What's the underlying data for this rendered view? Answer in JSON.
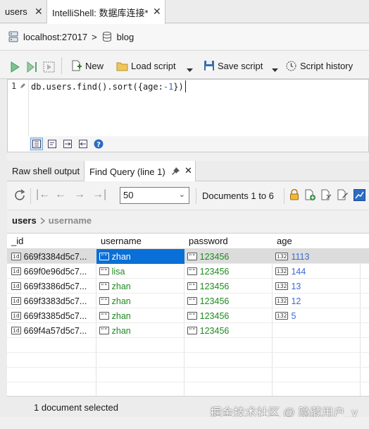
{
  "tabs": [
    {
      "label": "users",
      "close": "✕"
    },
    {
      "label": "IntelliShell: 数据库连接*",
      "close": "✕"
    }
  ],
  "connection": {
    "host": "localhost:27017",
    "separator": ">",
    "database": "blog"
  },
  "toolbar": {
    "new_label": "New",
    "load_label": "Load script",
    "save_label": "Save script",
    "history_label": "Script history"
  },
  "editor": {
    "line_number": "1",
    "code_prefix": "db.users.find().sort({age:",
    "code_number": "-1",
    "code_suffix": "})"
  },
  "result_tabs": [
    {
      "label": "Raw shell output"
    },
    {
      "label": "Find Query (line 1)"
    }
  ],
  "result_toolbar": {
    "page_size": "50",
    "documents_label": "Documents 1 to 6"
  },
  "collection_path": {
    "collection": "users",
    "field": "username"
  },
  "grid": {
    "columns": [
      "_id",
      "username",
      "password",
      "age"
    ],
    "rows": [
      {
        "id": "669f3384d5c7...",
        "username": "zhan",
        "password": "123456",
        "age": "1113"
      },
      {
        "id": "669f0e96d5c7...",
        "username": "lisa",
        "password": "123456",
        "age": "144"
      },
      {
        "id": "669f3386d5c7...",
        "username": "zhan",
        "password": "123456",
        "age": "13"
      },
      {
        "id": "669f3383d5c7...",
        "username": "zhan",
        "password": "123456",
        "age": "12"
      },
      {
        "id": "669f3385d5c7...",
        "username": "zhan",
        "password": "123456",
        "age": "5"
      },
      {
        "id": "669f4a57d5c7...",
        "username": "zhan",
        "password": "123456",
        "age": ""
      }
    ],
    "type_icons": {
      "id": "id",
      "string": "\"\"",
      "int": "i32"
    }
  },
  "status": {
    "selection": "1 document selected"
  },
  "watermark": "掘金技术社区 @ 隐藏用户_y",
  "colors": {
    "accent": "#0a6fd6",
    "string_value": "#1e8a1e",
    "number_value": "#3b6bd4",
    "run_green": "#3f9a5a"
  }
}
